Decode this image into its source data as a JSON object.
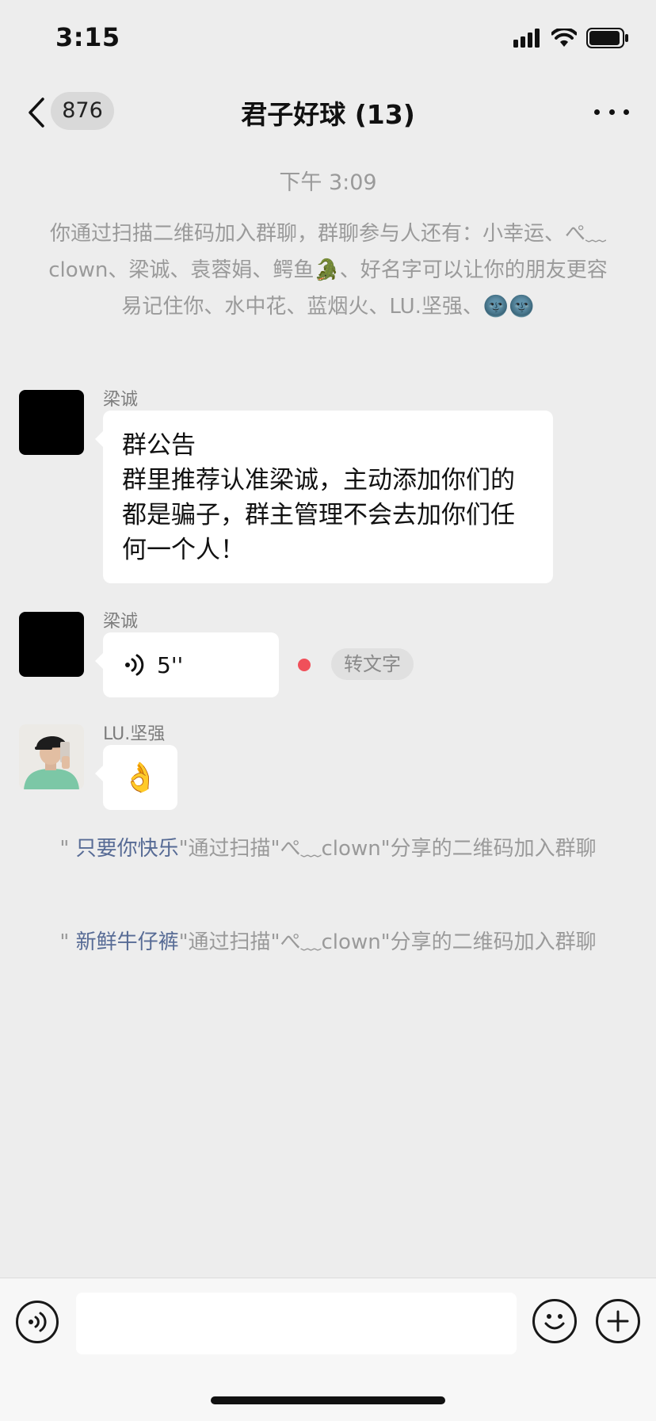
{
  "status_bar": {
    "time": "3:15"
  },
  "nav": {
    "unread_count": "876",
    "title": "君子好球 (13)"
  },
  "chat": {
    "time_divider": "下午 3:09",
    "join_notice": "你通过扫描二维码加入群聊，群聊参与人还有：小幸运、ぺ﹏clown、梁诚、袁蓉娟、鳄鱼🐊、好名字可以让你的朋友更容易记住你、水中花、蓝烟火、LU.坚强、🌚🌚",
    "messages": [
      {
        "sender": "梁诚",
        "type": "text",
        "text": "群公告\n群里推荐认准梁诚，主动添加你们的都是骗子，群主管理不会去加你们任何一个人！"
      },
      {
        "sender": "梁诚",
        "type": "voice",
        "duration": "5''",
        "transcribe_label": "转文字"
      },
      {
        "sender": "LU.坚强",
        "type": "emoji",
        "text": "👌"
      }
    ],
    "system_events": [
      {
        "prefix": "\" ",
        "user": "只要你快乐",
        "text": "\"通过扫描\"ぺ﹏clown\"分享的二维码加入群聊"
      },
      {
        "prefix": "\" ",
        "user": "新鲜牛仔裤",
        "text": "\"通过扫描\"ぺ﹏clown\"分享的二维码加入群聊"
      }
    ]
  },
  "input_bar": {
    "placeholder": ""
  },
  "colors": {
    "background": "#ededed",
    "system_text": "#9a9a9a",
    "link": "#576b95",
    "bubble": "#ffffff",
    "unread_dot": "#f0505a"
  }
}
